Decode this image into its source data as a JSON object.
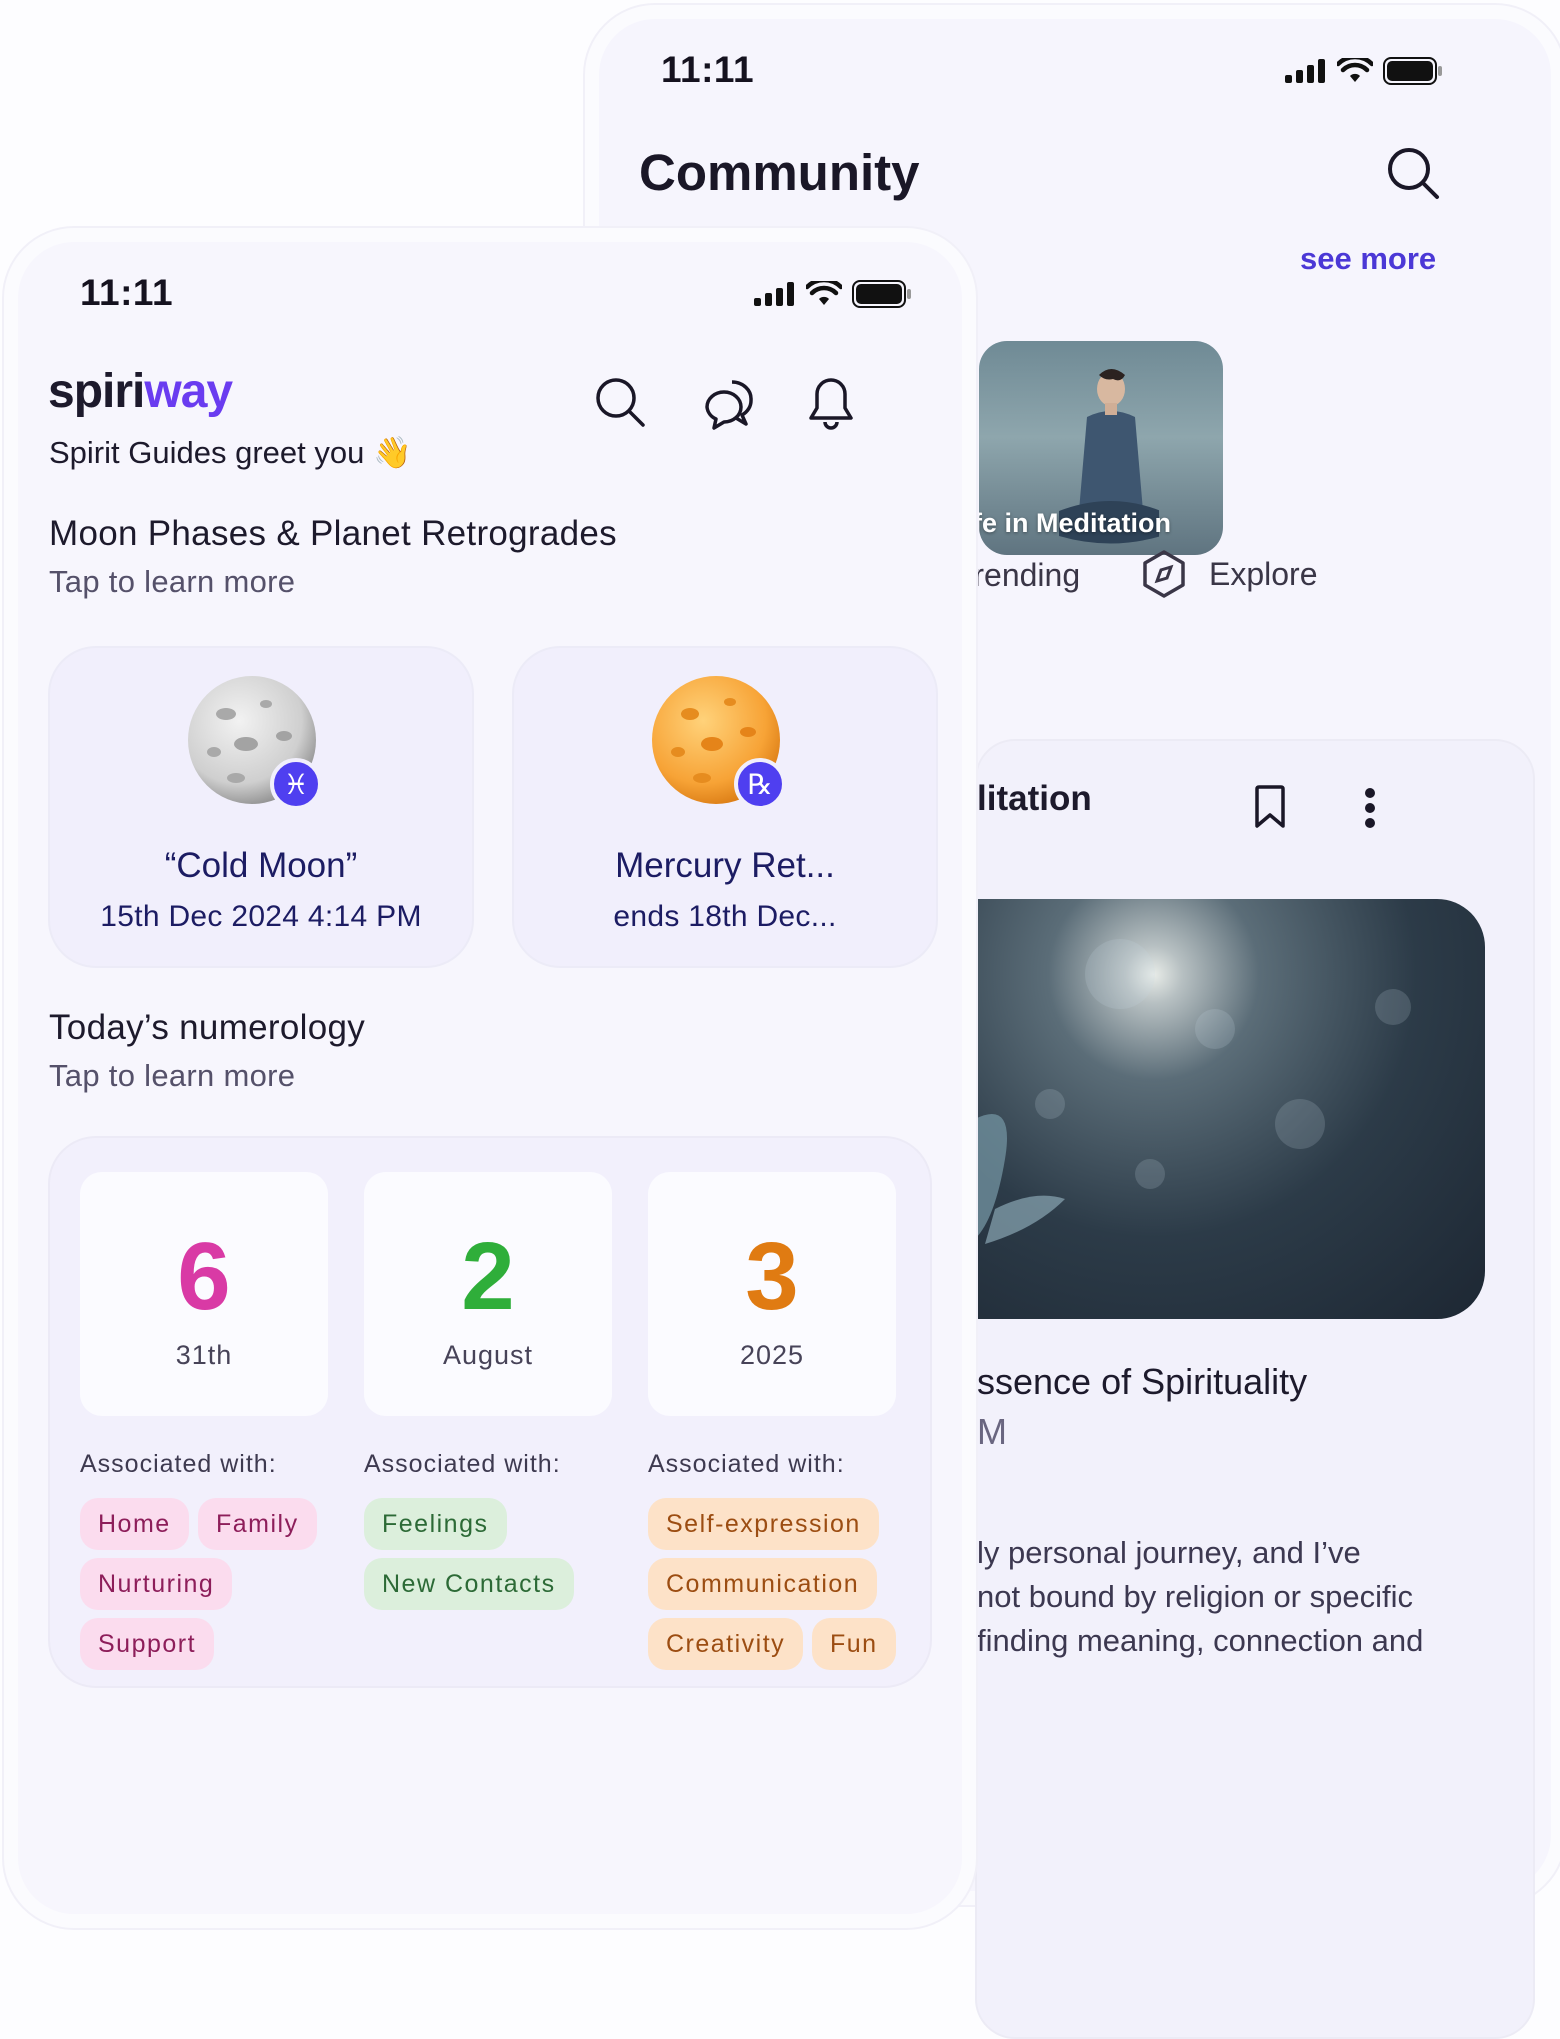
{
  "back_phone": {
    "status_time": "11:11",
    "title": "Community",
    "see_more": "see more",
    "story_caption": "fe in Meditation",
    "tabs": [
      "Trending",
      "Explore"
    ],
    "post": {
      "title": "litation",
      "subtitle": "ssence of Spirituality",
      "meta": "M",
      "body": [
        "ly personal journey, and I’ve",
        "not bound by religion or specific",
        "finding meaning, connection and"
      ]
    }
  },
  "front_phone": {
    "status_time": "11:11",
    "logo_part1": "spiri",
    "logo_part2": "way",
    "greeting": "Spirit Guides greet you 👋",
    "moon_section": {
      "title": "Moon Phases & Planet Retrogrades",
      "subtitle": "Tap to learn more",
      "cards": [
        {
          "title": "“Cold Moon”",
          "date": "15th Dec 2024 4:14 PM",
          "badge": "♓"
        },
        {
          "title": "Mercury Ret...",
          "date": "ends 18th Dec...",
          "badge": "℞"
        }
      ]
    },
    "numerology": {
      "title": "Today’s numerology",
      "subtitle": "Tap to learn more",
      "assoc_label": "Associated with:",
      "items": [
        {
          "number": "6",
          "label": "31th",
          "color": "#d93aa5",
          "tags": [
            "Home",
            "Family",
            "Nurturing",
            "Support"
          ]
        },
        {
          "number": "2",
          "label": "August",
          "color": "#2fae3a",
          "tags": [
            "Feelings",
            "New Contacts"
          ]
        },
        {
          "number": "3",
          "label": "2025",
          "color": "#e07b12",
          "tags": [
            "Self-expression",
            "Communication",
            "Creativity",
            "Fun"
          ]
        }
      ]
    }
  },
  "colors": {
    "accent": "#4b38d6",
    "logo_accent": "#6a3cf0",
    "badge": "#4f3ff0",
    "title_navy": "#1c1c63"
  }
}
